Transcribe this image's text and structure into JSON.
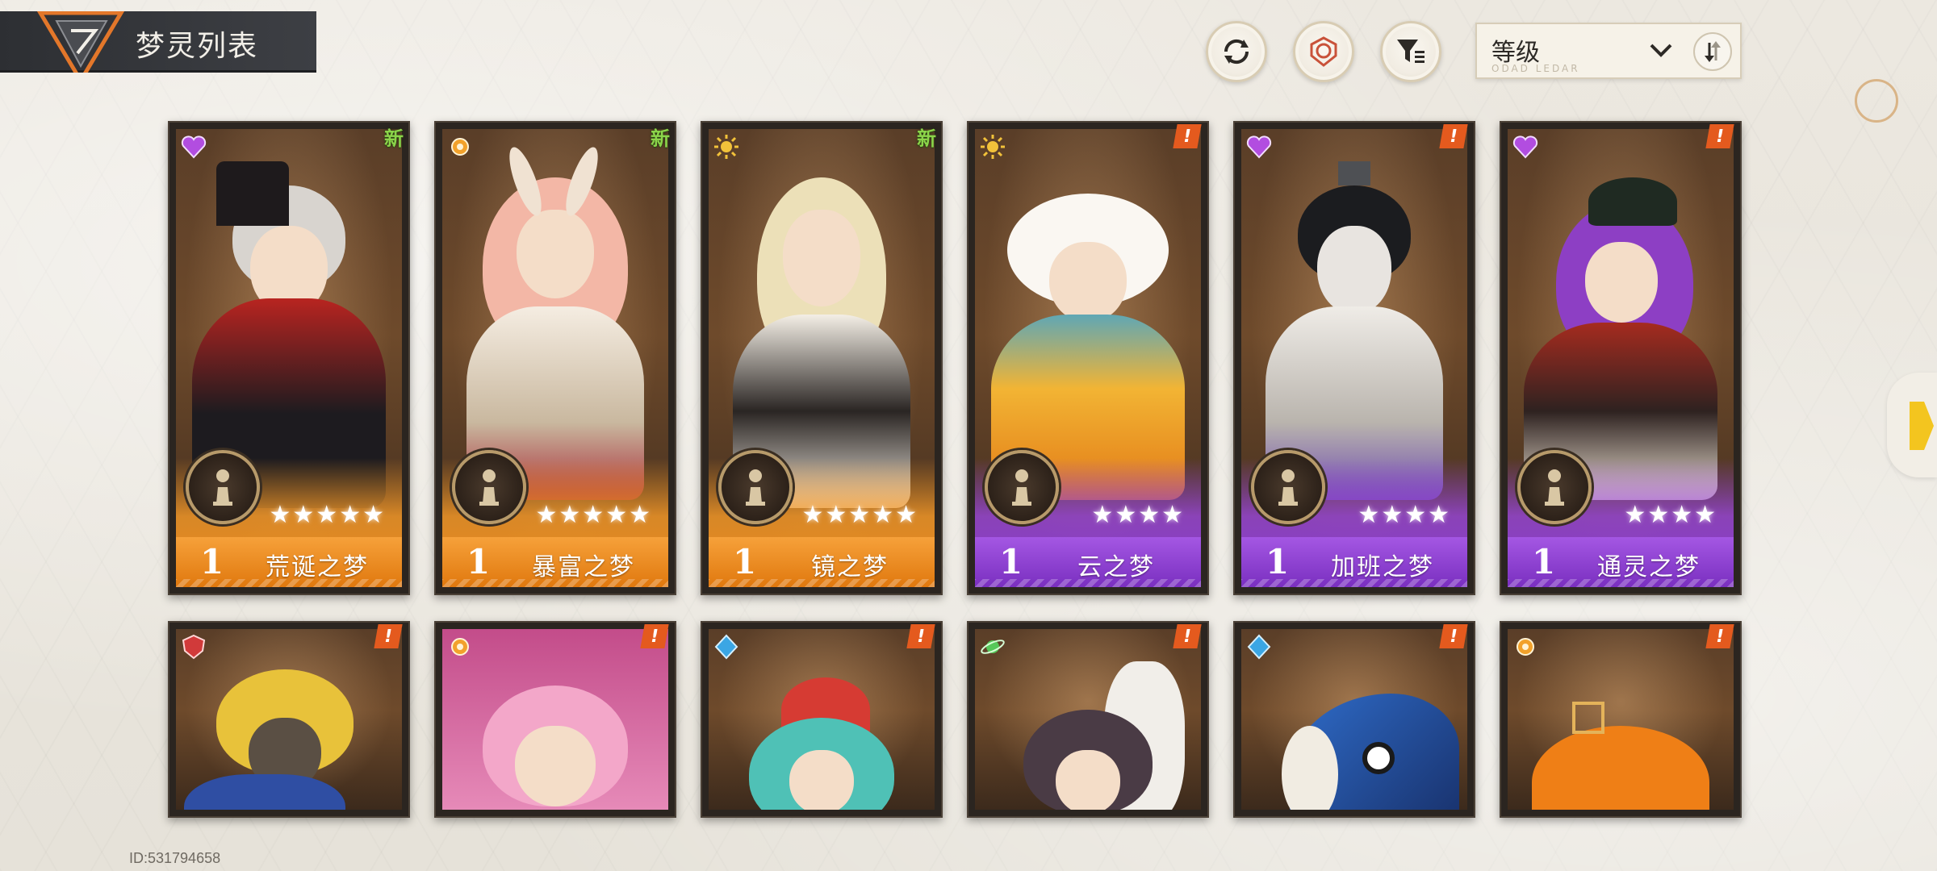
{
  "header": {
    "title": "梦灵列表"
  },
  "toolbar": {
    "refresh_icon": "refresh-icon",
    "target_icon": "target-icon",
    "filter_icon": "filter-icon",
    "sort": {
      "selected": "等级",
      "subtext": "ODAD LEDAR"
    }
  },
  "colors": {
    "orange": "#f08d1d",
    "purple": "#8a3bd0",
    "new_badge": "#8bd44a",
    "alert_badge": "#e45a1e"
  },
  "cards_row1": [
    {
      "name": "荒诞之梦",
      "level": "1",
      "stars": "★★★★★",
      "rarity": "orange",
      "badge": "新",
      "element_icon": "purple-heart-icon"
    },
    {
      "name": "暴富之梦",
      "level": "1",
      "stars": "★★★★★",
      "rarity": "orange",
      "badge": "新",
      "element_icon": "orange-orb-icon"
    },
    {
      "name": "镜之梦",
      "level": "1",
      "stars": "★★★★★",
      "rarity": "orange",
      "badge": "新",
      "element_icon": "sun-icon"
    },
    {
      "name": "云之梦",
      "level": "1",
      "stars": "★★★★",
      "rarity": "purple",
      "badge": "!",
      "element_icon": "sun-icon"
    },
    {
      "name": "加班之梦",
      "level": "1",
      "stars": "★★★★",
      "rarity": "purple",
      "badge": "!",
      "element_icon": "purple-heart-icon"
    },
    {
      "name": "通灵之梦",
      "level": "1",
      "stars": "★★★★",
      "rarity": "purple",
      "badge": "!",
      "element_icon": "purple-heart-icon"
    }
  ],
  "cards_row2": [
    {
      "badge": "!",
      "element_icon": "red-shield-icon"
    },
    {
      "badge": "!",
      "element_icon": "orange-orb-icon"
    },
    {
      "badge": "!",
      "element_icon": "blue-diamond-icon"
    },
    {
      "badge": "!",
      "element_icon": "green-planet-icon"
    },
    {
      "badge": "!",
      "element_icon": "blue-diamond-icon"
    },
    {
      "badge": "!",
      "element_icon": "orange-orb-icon"
    }
  ],
  "footer": {
    "player_id": "ID:531794658"
  }
}
